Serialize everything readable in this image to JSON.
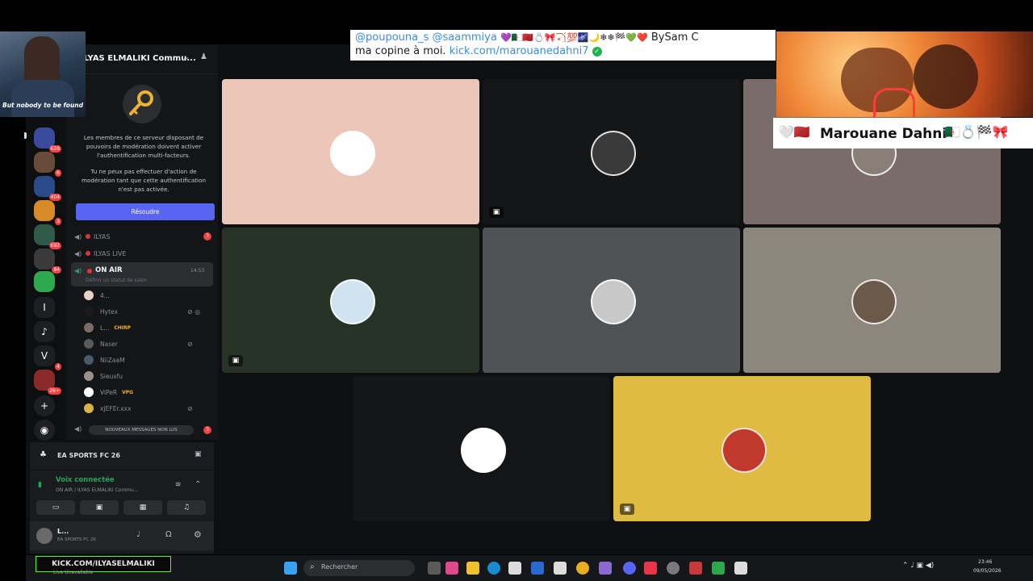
{
  "server": {
    "name": "ILYAS ELMALIKI Commu...",
    "mfa_notice": {
      "p1": "Les membres de ce serveur disposant de pouvoirs de modération doivent activer l'authentification multi-facteurs.",
      "p2": "Tu ne peux pas effectuer d'action de modération tant que cette authentification n'est pas activée.",
      "button": "Résoudre"
    },
    "badges": [
      "628",
      "6",
      "3",
      "404",
      "2",
      "692",
      "84",
      "6",
      "4",
      "26+"
    ]
  },
  "channels": [
    {
      "label": "ILYAS",
      "badge": "3"
    },
    {
      "label": "ILYAS LIVE"
    },
    {
      "label": "ON AIR",
      "time": "14:53",
      "status": "Définir un statut de salon"
    }
  ],
  "voice_users": [
    {
      "name": "4..."
    },
    {
      "name": "Hytex"
    },
    {
      "name": "L...",
      "tag": "CHIRP"
    },
    {
      "name": "Naser"
    },
    {
      "name": "NiiZaaM"
    },
    {
      "name": "Sieuxfu"
    },
    {
      "name": "ViPeR",
      "tag": "VPG"
    },
    {
      "name": "xJEFEr.xxx"
    }
  ],
  "new_messages_label": "NOUVEAUX MESSAGES NON LUS",
  "new_messages_badge": "3",
  "activity": {
    "game": "EA SPORTS FC 26"
  },
  "voice_status": {
    "title": "Voix connectée",
    "channel": "ON AIR / ILYAS ELMALIKI Commu..."
  },
  "user": {
    "name": "L...",
    "status": "EA SPORTS FC 26"
  },
  "overlays": {
    "left_caption": "But nobody to be found",
    "tweet_line1_mentions": "@poupouna_s @saammiya",
    "tweet_line1_end": "BySam C",
    "tweet_line2_text": "ma copine à moi.",
    "tweet_line2_link": "kick.com/marouanedahni7",
    "name_strip": "Marouane Dahni"
  },
  "taskbar": {
    "kick": "KICK.COM/ILYASELMALIKI",
    "kick_sub": "Live Unavailable",
    "search": "Rechercher",
    "time": "23:46",
    "date": "09/05/2026"
  },
  "tiles": [
    {
      "bg": "#ecc7b9"
    },
    {
      "bg": "#151617"
    },
    {
      "bg": "#7a6c68"
    },
    {
      "bg": "#273326"
    },
    {
      "bg": "#505356"
    },
    {
      "bg": "#8d867c"
    },
    {
      "bg": "#141516"
    },
    {
      "bg": "#dfbb42"
    }
  ]
}
